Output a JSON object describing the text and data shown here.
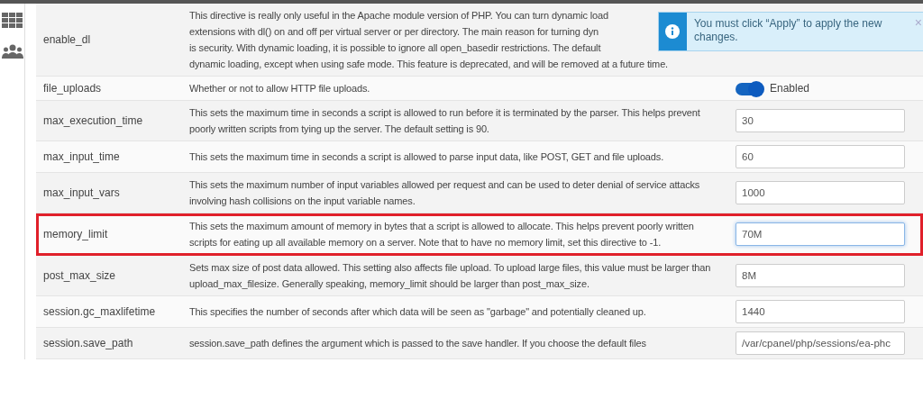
{
  "sidebar": {
    "items": [
      {
        "kind": "grid"
      },
      {
        "kind": "users"
      }
    ]
  },
  "directives": [
    {
      "name": "enable_dl",
      "description_lines": [
        "This directive is really only useful in the Apache module version of PHP. You can turn dynamic load",
        "extensions with dl() on and off per virtual server or per directory. The main reason for turning dyn",
        "is security. With dynamic loading, it is possible to ignore all open_basedir restrictions. The default",
        "dynamic loading, except when using safe mode. This feature is deprecated, and will be removed at a future time."
      ],
      "highlighted": false
    },
    {
      "name": "file_uploads",
      "description": "Whether or not to allow HTTP file uploads.",
      "control": {
        "kind": "toggle",
        "on": true,
        "label": "Enabled"
      },
      "highlighted": false
    },
    {
      "name": "max_execution_time",
      "description": "This sets the maximum time in seconds a script is allowed to run before it is terminated by the parser. This helps prevent poorly written scripts from tying up the server. The default setting is 90.",
      "control": {
        "kind": "text",
        "value": "30",
        "focused": false
      },
      "highlighted": false
    },
    {
      "name": "max_input_time",
      "description": "This sets the maximum time in seconds a script is allowed to parse input data, like POST, GET and file uploads.",
      "control": {
        "kind": "text",
        "value": "60",
        "focused": false
      },
      "highlighted": false
    },
    {
      "name": "max_input_vars",
      "description": "This sets the maximum number of input variables allowed per request and can be used to deter denial of service attacks involving hash collisions on the input variable names.",
      "control": {
        "kind": "text",
        "value": "1000",
        "focused": false
      },
      "highlighted": false
    },
    {
      "name": "memory_limit",
      "description": "This sets the maximum amount of memory in bytes that a script is allowed to allocate. This helps prevent poorly written scripts for eating up all available memory on a server. Note that to have no memory limit, set this directive to -1.",
      "control": {
        "kind": "text",
        "value": "70M",
        "focused": true
      },
      "highlighted": true
    },
    {
      "name": "post_max_size",
      "description": "Sets max size of post data allowed. This setting also affects file upload. To upload large files, this value must be larger than upload_max_filesize. Generally speaking, memory_limit should be larger than post_max_size.",
      "control": {
        "kind": "text",
        "value": "8M",
        "focused": false
      },
      "highlighted": false
    },
    {
      "name": "session.gc_maxlifetime",
      "description": "This specifies the number of seconds after which data will be seen as \"garbage\" and potentially cleaned up.",
      "control": {
        "kind": "text",
        "value": "1440",
        "focused": false
      },
      "highlighted": false
    },
    {
      "name": "session.save_path",
      "description": "session.save_path defines the argument which is passed to the save handler. If you choose the default files",
      "control": {
        "kind": "text",
        "value": "/var/cpanel/php/sessions/ea-phc",
        "focused": false
      },
      "highlighted": false
    }
  ],
  "toast": {
    "message": "You must click “Apply” to apply the new changes.",
    "close": "×"
  }
}
